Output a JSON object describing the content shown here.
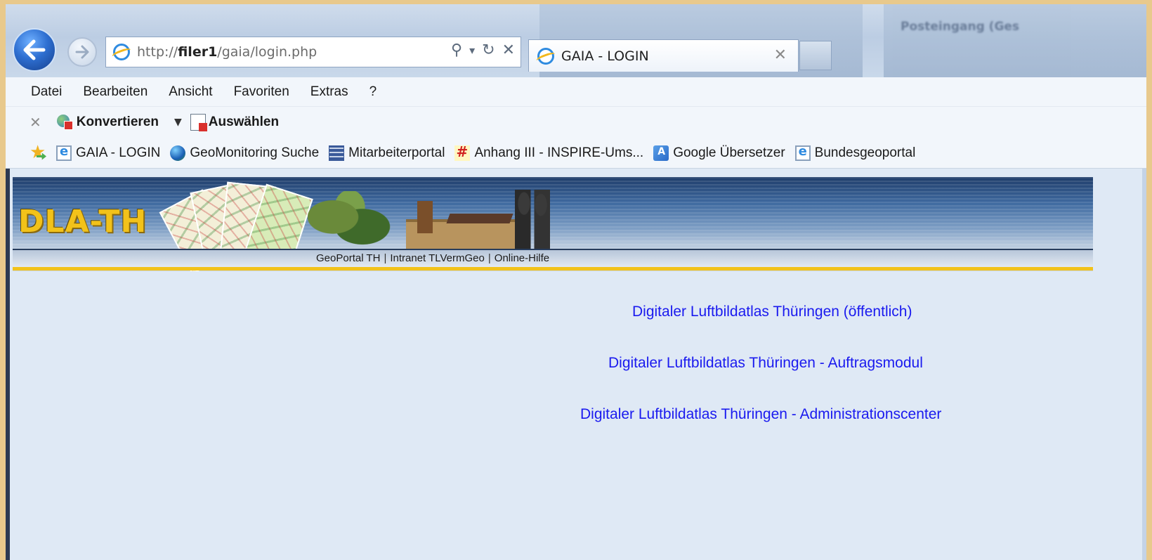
{
  "browser": {
    "background_window_title": "Posteingang (Ges",
    "address_url_prefix": "http://",
    "address_url_host": "filer1",
    "address_url_path": "/gaia/login.php",
    "address_tools": {
      "search": "⚲",
      "dropdown": "▾",
      "refresh": "↻",
      "stop": "✕"
    },
    "tab_title": "GAIA - LOGIN",
    "tab_close": "✕"
  },
  "menu": [
    "Datei",
    "Bearbeiten",
    "Ansicht",
    "Favoriten",
    "Extras",
    "?"
  ],
  "pdf_toolbar": {
    "close": "✕",
    "convert_label": "Konvertieren",
    "dropdown": "▼",
    "select_label": "Auswählen"
  },
  "favorites": [
    {
      "label": "GAIA - LOGIN",
      "icon": "ie-page-icon"
    },
    {
      "label": "GeoMonitoring  Suche",
      "icon": "globe-icon"
    },
    {
      "label": "Mitarbeiterportal",
      "icon": "portal-icon"
    },
    {
      "label": "Anhang III - INSPIRE-Ums...",
      "icon": "hash-icon"
    },
    {
      "label": "Google Übersetzer",
      "icon": "translate-icon"
    },
    {
      "label": "Bundesgeoportal",
      "icon": "ie-page-icon"
    }
  ],
  "banner": {
    "logo_text": "DLA-TH",
    "nav": [
      "GeoPortal TH",
      "Intranet TLVermGeo",
      "Online-Hilfe"
    ],
    "separator": "|",
    "accent_color": "#f2c21a"
  },
  "content_links": [
    "Digitaler Luftbildatlas Thüringen (öffentlich)",
    "Digitaler Luftbildatlas Thüringen - Auftragsmodul",
    "Digitaler Luftbildatlas Thüringen - Administrationscenter"
  ],
  "colors": {
    "link": "#1a1aef",
    "page_background": "#dfe9f5"
  }
}
